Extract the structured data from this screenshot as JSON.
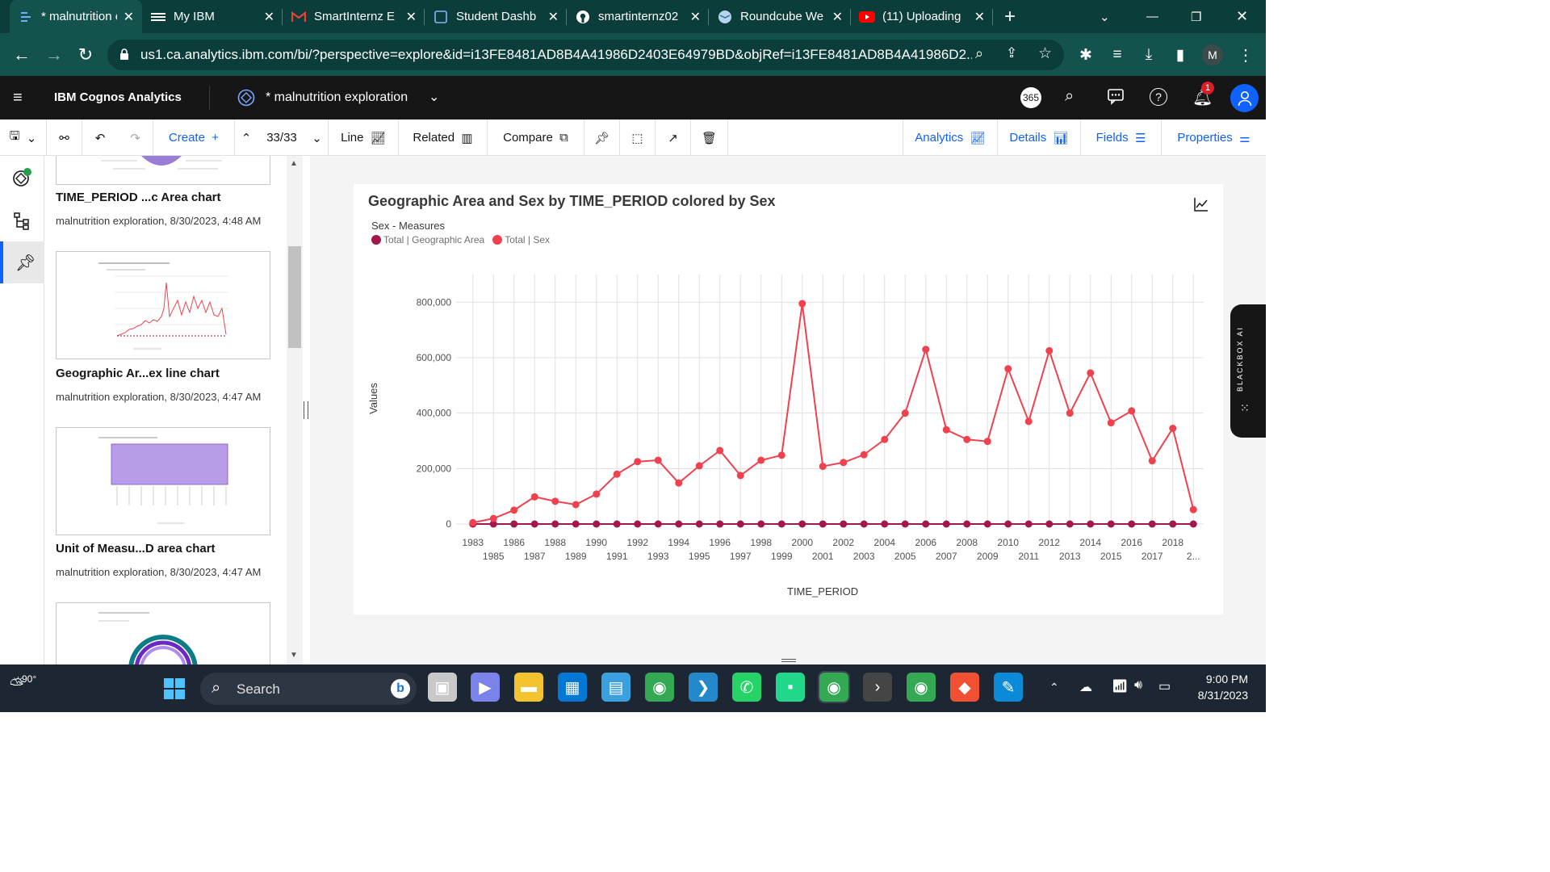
{
  "browser": {
    "tabs": [
      {
        "label": "* malnutrition e",
        "active": true,
        "icon": "cognos-icon"
      },
      {
        "label": "My IBM",
        "active": false,
        "icon": "ibm-icon"
      },
      {
        "label": "SmartInternz E",
        "active": false,
        "icon": "gmail-icon"
      },
      {
        "label": "Student Dashb",
        "active": false,
        "icon": "page-icon"
      },
      {
        "label": "smartinternz02",
        "active": false,
        "icon": "github-icon"
      },
      {
        "label": "Roundcube We",
        "active": false,
        "icon": "roundcube-icon"
      },
      {
        "label": "(11) Uploading",
        "active": false,
        "icon": "youtube-icon"
      }
    ],
    "url": "us1.ca.analytics.ibm.com/bi/?perspective=explore&id=i13FE8481AD8B4A41986D2403E64979BD&objRef=i13FE8481AD8B4A41986D2...",
    "profile_initial": "M"
  },
  "cognos": {
    "product": "IBM Cognos Analytics",
    "doc_title": "* malnutrition exploration",
    "badge": "365",
    "notifications": "1"
  },
  "toolbar": {
    "create": "Create",
    "nav_count": "33/33",
    "line": "Line",
    "related": "Related",
    "compare": "Compare",
    "analytics": "Analytics",
    "details": "Details",
    "fields": "Fields",
    "properties": "Properties"
  },
  "cards": [
    {
      "title": "TIME_PERIOD ...c Area chart",
      "meta": "malnutrition exploration, 8/30/2023, 4:48 AM"
    },
    {
      "title": "Geographic Ar...ex line chart",
      "meta": "malnutrition exploration, 8/30/2023, 4:47 AM"
    },
    {
      "title": "Unit of Measu...D area chart",
      "meta": "malnutrition exploration, 8/30/2023, 4:47 AM"
    }
  ],
  "chart_data": {
    "type": "line",
    "title": "Geographic Area and Sex by TIME_PERIOD colored by Sex",
    "legend_title": "Sex - Measures",
    "xlabel": "TIME_PERIOD",
    "ylabel": "Values",
    "ylim": [
      0,
      900000
    ],
    "yticks": [
      "0",
      "200,000",
      "400,000",
      "600,000",
      "800,000"
    ],
    "ytick_values": [
      0,
      200000,
      400000,
      600000,
      800000
    ],
    "x": [
      "1983",
      "1985",
      "1986",
      "1987",
      "1988",
      "1989",
      "1990",
      "1991",
      "1992",
      "1993",
      "1994",
      "1995",
      "1996",
      "1997",
      "1998",
      "1999",
      "2000",
      "2001",
      "2002",
      "2003",
      "2004",
      "2005",
      "2006",
      "2007",
      "2008",
      "2009",
      "2010",
      "2011",
      "2012",
      "2013",
      "2014",
      "2015",
      "2016",
      "2017",
      "2018",
      "2..."
    ],
    "x_top_labels": [
      "1983",
      "1986",
      "1988",
      "1990",
      "1992",
      "1994",
      "1996",
      "1998",
      "2000",
      "2002",
      "2004",
      "2006",
      "2008",
      "2010",
      "2012",
      "2014",
      "2016",
      "2018"
    ],
    "x_bottom_labels": [
      "1985",
      "1987",
      "1989",
      "1991",
      "1993",
      "1995",
      "1997",
      "1999",
      "2001",
      "2003",
      "2005",
      "2007",
      "2009",
      "2011",
      "2013",
      "2015",
      "2017",
      "2..."
    ],
    "series": [
      {
        "name": "Total | Geographic Area",
        "color": "#a3174e",
        "values": [
          0,
          0,
          0,
          0,
          0,
          0,
          0,
          0,
          0,
          0,
          0,
          0,
          0,
          0,
          0,
          0,
          0,
          0,
          0,
          0,
          0,
          0,
          0,
          0,
          0,
          0,
          0,
          0,
          0,
          0,
          0,
          0,
          0,
          0,
          0,
          0
        ]
      },
      {
        "name": "Total | Sex",
        "color": "#f0424e",
        "values": [
          5000,
          20000,
          50000,
          98000,
          82000,
          70000,
          108000,
          180000,
          225000,
          230000,
          148000,
          210000,
          265000,
          175000,
          230000,
          248000,
          795000,
          208000,
          222000,
          250000,
          305000,
          400000,
          630000,
          340000,
          305000,
          298000,
          560000,
          370000,
          625000,
          400000,
          545000,
          365000,
          408000,
          228000,
          345000,
          52000
        ]
      }
    ]
  },
  "system": {
    "weather": "90°",
    "search": "Search",
    "time": "9:00 PM",
    "date": "8/31/2023",
    "blackbox": "BLACKBOX AI"
  }
}
